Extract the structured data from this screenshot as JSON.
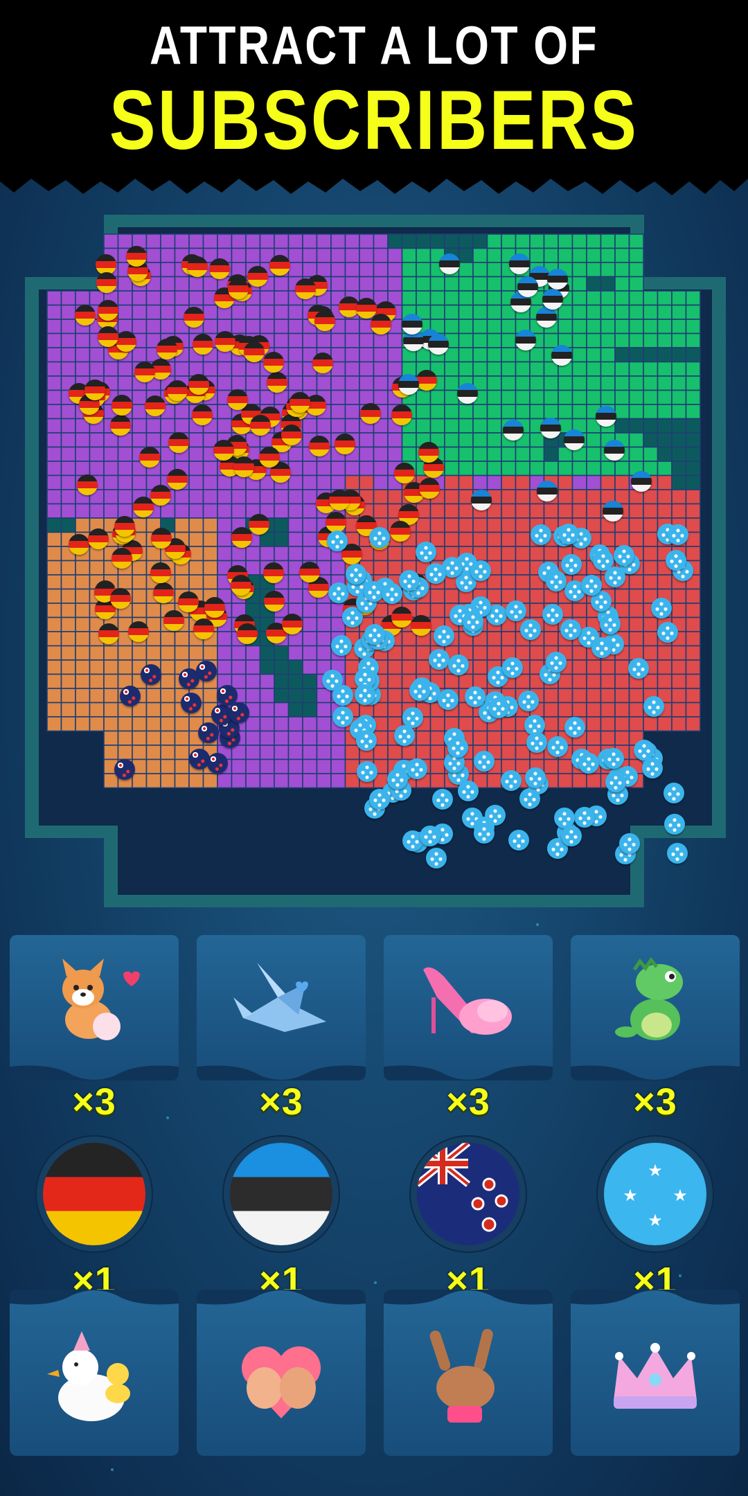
{
  "header": {
    "line1": "ATTRACT A LOT OF",
    "line2": "SUBSCRIBERS"
  },
  "colors": {
    "header_bg": "#000000",
    "line1": "#ffffff",
    "line2": "#f6ff1a",
    "purple_team": "#a24fd4",
    "green_team": "#17c06d",
    "red_team": "#e04b4b",
    "orange_team": "#e08b4a",
    "empty_cell": "#0d5a5e",
    "multiplier": "#f6ff1a"
  },
  "board": {
    "teams": [
      {
        "name": "germany-flag-icon",
        "color": "#a24fd4"
      },
      {
        "name": "estonia-flag-icon",
        "color": "#17c06d"
      },
      {
        "name": "micronesia-flag-icon",
        "color": "#e04b4b"
      },
      {
        "name": "new-zealand-flag-icon",
        "color": "#e08b4a"
      }
    ]
  },
  "gifts_top": [
    {
      "icon": "corgi-gift-icon",
      "multiplier": "×3"
    },
    {
      "icon": "paper-crane-gift-icon",
      "multiplier": "×3"
    },
    {
      "icon": "pink-slipper-gift-icon",
      "multiplier": "×3"
    },
    {
      "icon": "dinosaur-gift-icon",
      "multiplier": "×3"
    }
  ],
  "flags": [
    {
      "icon": "germany-flag-icon",
      "multiplier": "×1"
    },
    {
      "icon": "estonia-flag-icon",
      "multiplier": "×1"
    },
    {
      "icon": "new-zealand-flag-icon",
      "multiplier": "×1"
    },
    {
      "icon": "micronesia-flag-icon",
      "multiplier": "×1"
    }
  ],
  "gifts_bottom": [
    {
      "icon": "duck-gift-icon"
    },
    {
      "icon": "heart-hands-gift-icon"
    },
    {
      "icon": "rock-hand-gift-icon"
    },
    {
      "icon": "crown-gift-icon"
    }
  ]
}
